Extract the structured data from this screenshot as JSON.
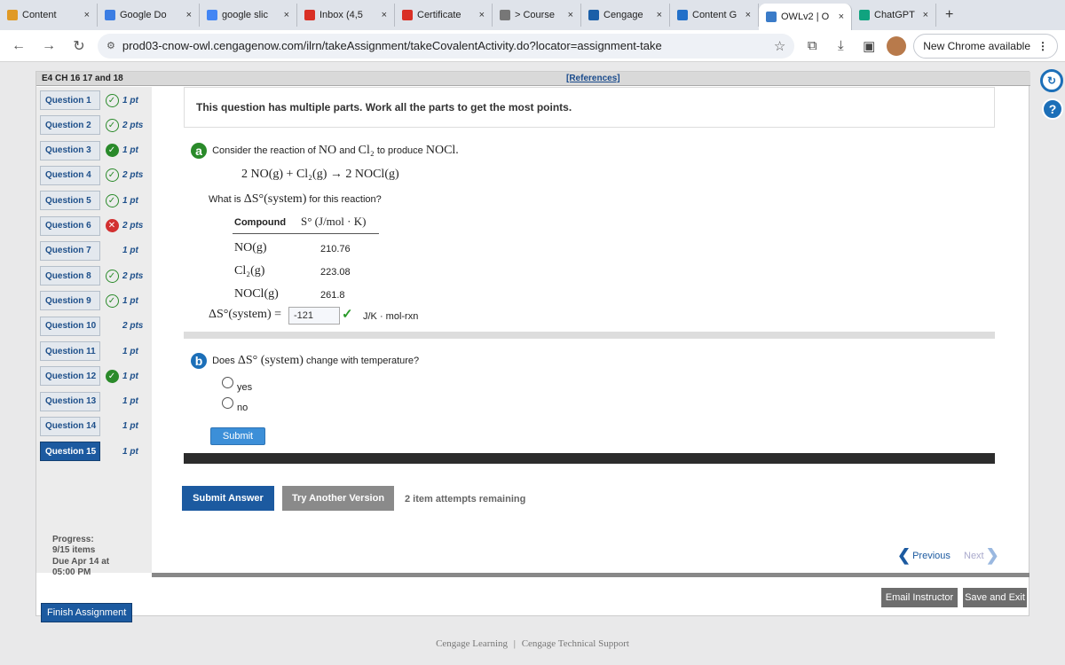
{
  "browser": {
    "tabs": [
      {
        "label": "Content",
        "icon": "bar-chart-icon",
        "color": "#e09a26"
      },
      {
        "label": "Google Do",
        "icon": "google-docs-icon",
        "color": "#3b7de3"
      },
      {
        "label": "google slic",
        "icon": "google-icon",
        "color": "#4285f4"
      },
      {
        "label": "Inbox (4,5",
        "icon": "gmail-icon",
        "color": "#d93025"
      },
      {
        "label": "Certificate",
        "icon": "gmail-icon",
        "color": "#d93025"
      },
      {
        "label": "> Course",
        "icon": "globe-icon",
        "color": "#777777"
      },
      {
        "label": "Cengage",
        "icon": "cengage-icon",
        "color": "#1a5fa8"
      },
      {
        "label": "Content G",
        "icon": "bartleby-icon",
        "color": "#2270c9"
      },
      {
        "label": "OWLv2 | O",
        "icon": "owl-icon",
        "color": "#3a7bc8",
        "active": true
      },
      {
        "label": "ChatGPT",
        "icon": "chatgpt-icon",
        "color": "#10a37f"
      }
    ],
    "close_glyph": "×",
    "new_tab_glyph": "+",
    "url": "prod03-cnow-owl.cengagenow.com/ilrn/takeAssignment/takeCovalentActivity.do?locator=assignment-take",
    "update_label": "New Chrome available"
  },
  "assignment": {
    "title": "E4 CH 16 17 and 18",
    "references_label": "[References]",
    "questions": [
      {
        "label": "Question 1",
        "points": "1 pt",
        "status": "correct"
      },
      {
        "label": "Question 2",
        "points": "2 pts",
        "status": "correct"
      },
      {
        "label": "Question 3",
        "points": "1 pt",
        "status": "partial"
      },
      {
        "label": "Question 4",
        "points": "2 pts",
        "status": "correct"
      },
      {
        "label": "Question 5",
        "points": "1 pt",
        "status": "correct"
      },
      {
        "label": "Question 6",
        "points": "2 pts",
        "status": "incorrect"
      },
      {
        "label": "Question 7",
        "points": "1 pt",
        "status": "none"
      },
      {
        "label": "Question 8",
        "points": "2 pts",
        "status": "correct"
      },
      {
        "label": "Question 9",
        "points": "1 pt",
        "status": "correct"
      },
      {
        "label": "Question 10",
        "points": "2 pts",
        "status": "none"
      },
      {
        "label": "Question 11",
        "points": "1 pt",
        "status": "none"
      },
      {
        "label": "Question 12",
        "points": "1 pt",
        "status": "partial"
      },
      {
        "label": "Question 13",
        "points": "1 pt",
        "status": "none"
      },
      {
        "label": "Question 14",
        "points": "1 pt",
        "status": "none"
      },
      {
        "label": "Question 15",
        "points": "1 pt",
        "status": "none",
        "active": true
      }
    ],
    "progress_label": "Progress:",
    "progress_value": "9/15 items",
    "due_label": "Due Apr 14 at",
    "due_time": "05:00 PM",
    "finish_label": "Finish Assignment"
  },
  "question": {
    "instructions": "This question has multiple parts. Work all the parts to get the most points.",
    "part_a": {
      "letter": "a",
      "color": "#2a8a2a",
      "prompt_pre": "Consider the reaction of",
      "prompt_no": "NO",
      "prompt_mid": "and",
      "prompt_cl2": "Cl₂",
      "prompt_post": "to produce",
      "prompt_nocl": "NOCl.",
      "equation": "2 NO(g) + Cl₂(g) → 2 NOCl(g)",
      "question_pre": "What is",
      "question_sym": "ΔS°(system)",
      "question_post": "for this reaction?",
      "table": {
        "headers": [
          "Compound",
          "S° (J/mol · K)"
        ],
        "rows": [
          {
            "compound": "NO(g)",
            "value": "210.76"
          },
          {
            "compound": "Cl₂(g)",
            "value": "223.08"
          },
          {
            "compound": "NOCl(g)",
            "value": "261.8"
          }
        ]
      },
      "answer_label": "ΔS°(system) =",
      "answer_value": "-121",
      "answer_unit": "J/K · mol-rxn",
      "answer_correct": true
    },
    "part_b": {
      "letter": "b",
      "color": "#1c6fb8",
      "prompt_pre": "Does",
      "prompt_sym": "ΔS° (system)",
      "prompt_post": "change with temperature?",
      "options": [
        "yes",
        "no"
      ],
      "submit_label": "Submit"
    }
  },
  "actions": {
    "submit_answer": "Submit Answer",
    "try_another": "Try Another Version",
    "attempts": "2 item attempts remaining",
    "previous": "Previous",
    "next": "Next",
    "email_instructor": "Email Instructor",
    "save_exit": "Save and Exit"
  },
  "footer": {
    "left": "Cengage Learning",
    "divider": "|",
    "right": "Cengage Technical Support"
  }
}
